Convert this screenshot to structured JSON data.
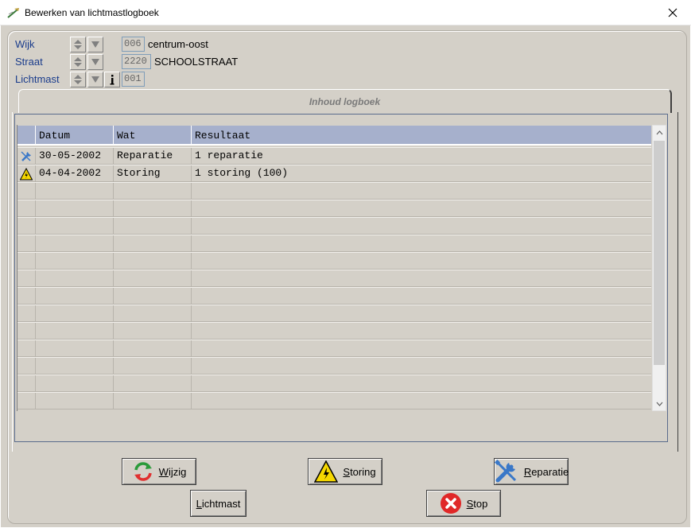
{
  "window": {
    "title": "Bewerken van lichtmastlogboek",
    "icon": "lightpole-icon"
  },
  "fields": {
    "wijk": {
      "label": "Wijk",
      "code": "006",
      "name": "centrum-oost"
    },
    "straat": {
      "label": "Straat",
      "code": "2220",
      "name": "SCHOOLSTRAAT"
    },
    "lichtmast": {
      "label": "Lichtmast",
      "code": "001"
    }
  },
  "tab": {
    "label": "Inhoud logboek"
  },
  "grid": {
    "columns": [
      "Datum",
      "Wat",
      "Resultaat"
    ],
    "rows": [
      {
        "icon": "wrench-icon",
        "datum": "30-05-2002",
        "wat": "Reparatie",
        "resultaat": "1 reparatie"
      },
      {
        "icon": "warning-icon",
        "datum": "04-04-2002",
        "wat": "Storing",
        "resultaat": "1 storing (100)"
      }
    ]
  },
  "buttons": {
    "wijzig": "Wijzig",
    "storing": "Storing",
    "reparatie": "Reparatie",
    "lichtmast": "Lichtmast",
    "stop": "Stop"
  },
  "colors": {
    "label_blue": "#1a3c8c",
    "header_bg": "#a6b0cc",
    "window_bg": "#d4d0c8"
  }
}
